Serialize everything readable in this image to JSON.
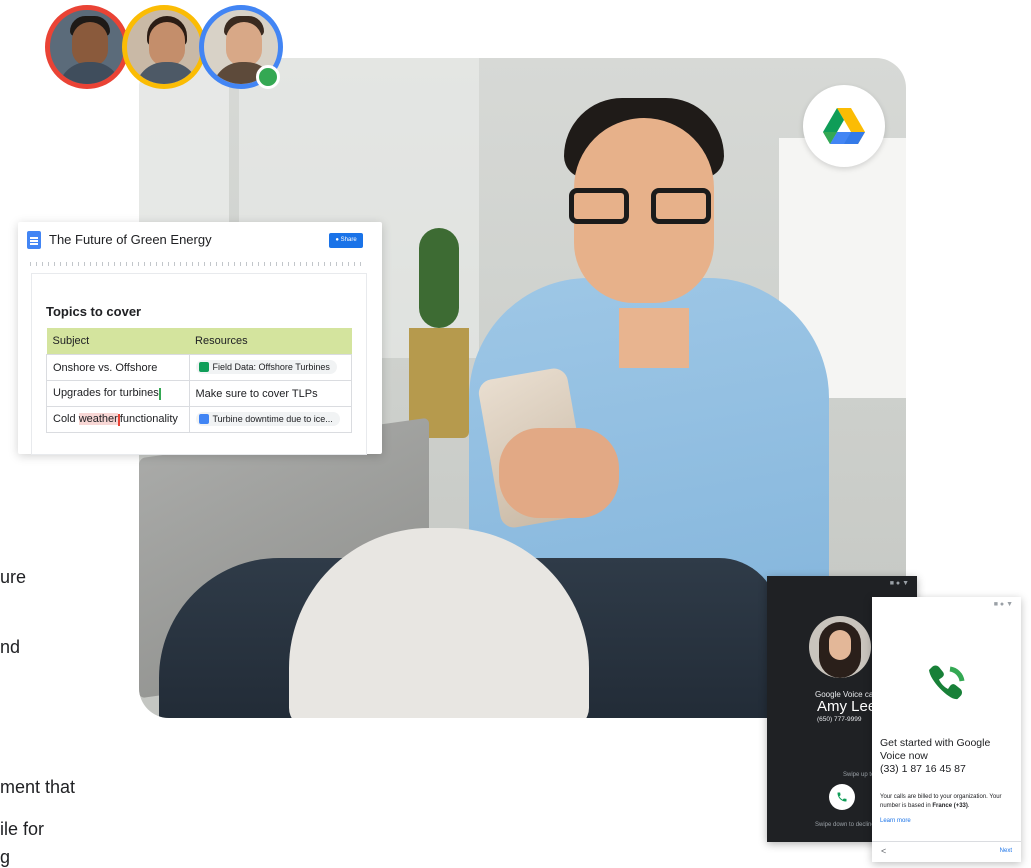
{
  "left_copy_fragments": [
    "ure",
    "nd",
    "ment that",
    "ile for",
    "g"
  ],
  "avatars": [
    {
      "name": "collaborator-1",
      "ring_color": "#ea4335"
    },
    {
      "name": "collaborator-2",
      "ring_color": "#fbbc04"
    },
    {
      "name": "collaborator-3",
      "ring_color": "#4285f4",
      "online": true
    }
  ],
  "drive_badge": {
    "icon": "google-drive-icon"
  },
  "docs_card": {
    "title": "The Future of Green Energy",
    "share_label": "Share",
    "section_heading": "Topics to cover",
    "table": {
      "headers": [
        "Subject",
        "Resources"
      ],
      "header_color": "#d4e49e",
      "rows": [
        {
          "subject": "Onshore vs. Offshore",
          "resource": "Field Data: Offshore Turbines",
          "resource_type": "chip-sheets"
        },
        {
          "subject": "Upgrades for turbines",
          "resource": "Make sure to cover TLPs",
          "resource_type": "text"
        },
        {
          "subject_pre": "Cold ",
          "subject_highlight": "weather",
          "subject_post": "functionality",
          "resource": "Turbine downtime due to ice...",
          "resource_type": "chip-docs"
        }
      ]
    }
  },
  "incoming_call": {
    "label": "Google Voice cal",
    "caller_name": "Amy Lee",
    "caller_number": "(650) 777-9999",
    "swipe_up": "Swipe up to answer",
    "swipe_down": "Swipe down to decline"
  },
  "voice_setup": {
    "headline": "Get started with Google Voice now",
    "number": "(33) 1 87 16 45 87",
    "body_pre": "Your calls are billed to your organization. Your number is based in ",
    "body_bold": "France (+33)",
    "body_post": ".",
    "learn_more": "Learn more",
    "back_label": "<",
    "next_label": "Next"
  },
  "colors": {
    "google_blue": "#4285f4",
    "google_red": "#ea4335",
    "google_yellow": "#fbbc04",
    "google_green": "#34a853"
  }
}
